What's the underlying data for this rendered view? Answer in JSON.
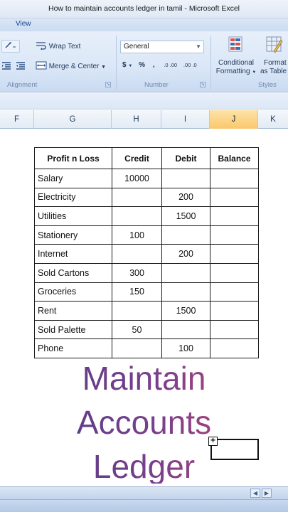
{
  "window": {
    "title": "How to maintain accounts ledger in tamil  -  Microsoft Excel"
  },
  "ribbon": {
    "tab": "View",
    "wrap_text": "Wrap Text",
    "merge_center": "Merge & Center",
    "number_format": "General",
    "currency_symbol": "$",
    "percent_symbol": "%",
    "comma_symbol": ",",
    "increase_decimal": ".0 .00",
    "decrease_decimal": ".00 .0",
    "conditional_formatting_line1": "Conditional",
    "conditional_formatting_line2": "Formatting",
    "format_as_table_line1": "Format",
    "format_as_table_line2": "as Table",
    "group_alignment": "Alignment",
    "group_number": "Number",
    "group_styles": "Styles"
  },
  "columns": [
    "F",
    "G",
    "H",
    "I",
    "J",
    "K"
  ],
  "active_column": "J",
  "ledger": {
    "headers": [
      "Profit n Loss",
      "Credit",
      "Debit",
      "Balance"
    ],
    "rows": [
      {
        "item": "Salary",
        "credit": "10000",
        "debit": "",
        "balance": ""
      },
      {
        "item": "Electricity",
        "credit": "",
        "debit": "200",
        "balance": ""
      },
      {
        "item": "Utilities",
        "credit": "",
        "debit": "1500",
        "balance": ""
      },
      {
        "item": "Stationery",
        "credit": "100",
        "debit": "",
        "balance": ""
      },
      {
        "item": "Internet",
        "credit": "",
        "debit": "200",
        "balance": ""
      },
      {
        "item": "Sold Cartons",
        "credit": "300",
        "debit": "",
        "balance": ""
      },
      {
        "item": "Groceries",
        "credit": "150",
        "debit": "",
        "balance": ""
      },
      {
        "item": "Rent",
        "credit": "",
        "debit": "1500",
        "balance": ""
      },
      {
        "item": "Sold Palette",
        "credit": "50",
        "debit": "",
        "balance": ""
      },
      {
        "item": "Phone",
        "credit": "",
        "debit": "100",
        "balance": ""
      }
    ]
  },
  "overlay": {
    "line1": "Maintain",
    "line2": "Accounts",
    "line3": "Ledger"
  },
  "colors": {
    "active_column": "#f9c86b",
    "overlay_start": "#4a3a86",
    "overlay_end": "#c54a6a"
  },
  "icons": [
    "orientation-icon",
    "wrap-text-icon",
    "indent-icon",
    "merge-icon",
    "conditional-formatting-icon",
    "format-table-icon",
    "move-cursor-icon"
  ]
}
